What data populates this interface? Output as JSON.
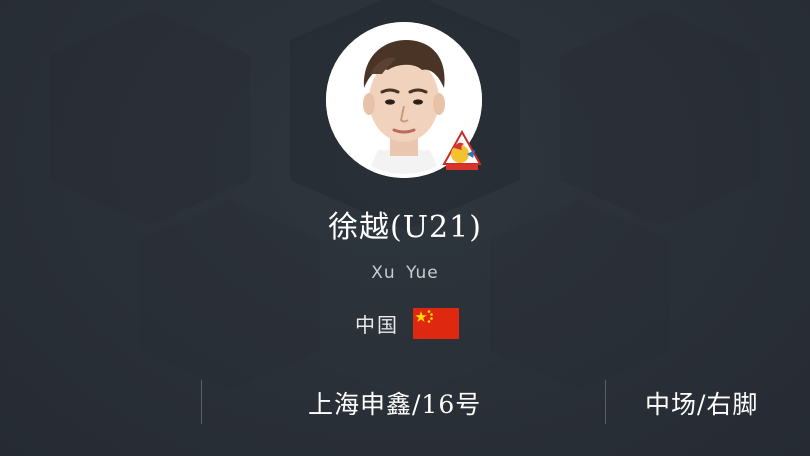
{
  "player": {
    "name_cn": "徐越(U21)",
    "name_en": "Xu Yue",
    "photo_icon": "player-portrait",
    "club_badge_icon": "club-badge-rooster"
  },
  "nationality": {
    "label": "中国",
    "flag_icon": "china-flag",
    "flag_color": "#de2910",
    "star_color": "#ffde00"
  },
  "info": {
    "club_number": "上海申鑫/16号",
    "position_foot": "中场/右脚"
  },
  "colors": {
    "background": "#2a3038",
    "text_primary": "#ffffff",
    "text_secondary": "#c9cdd2",
    "divider": "#59606a"
  }
}
